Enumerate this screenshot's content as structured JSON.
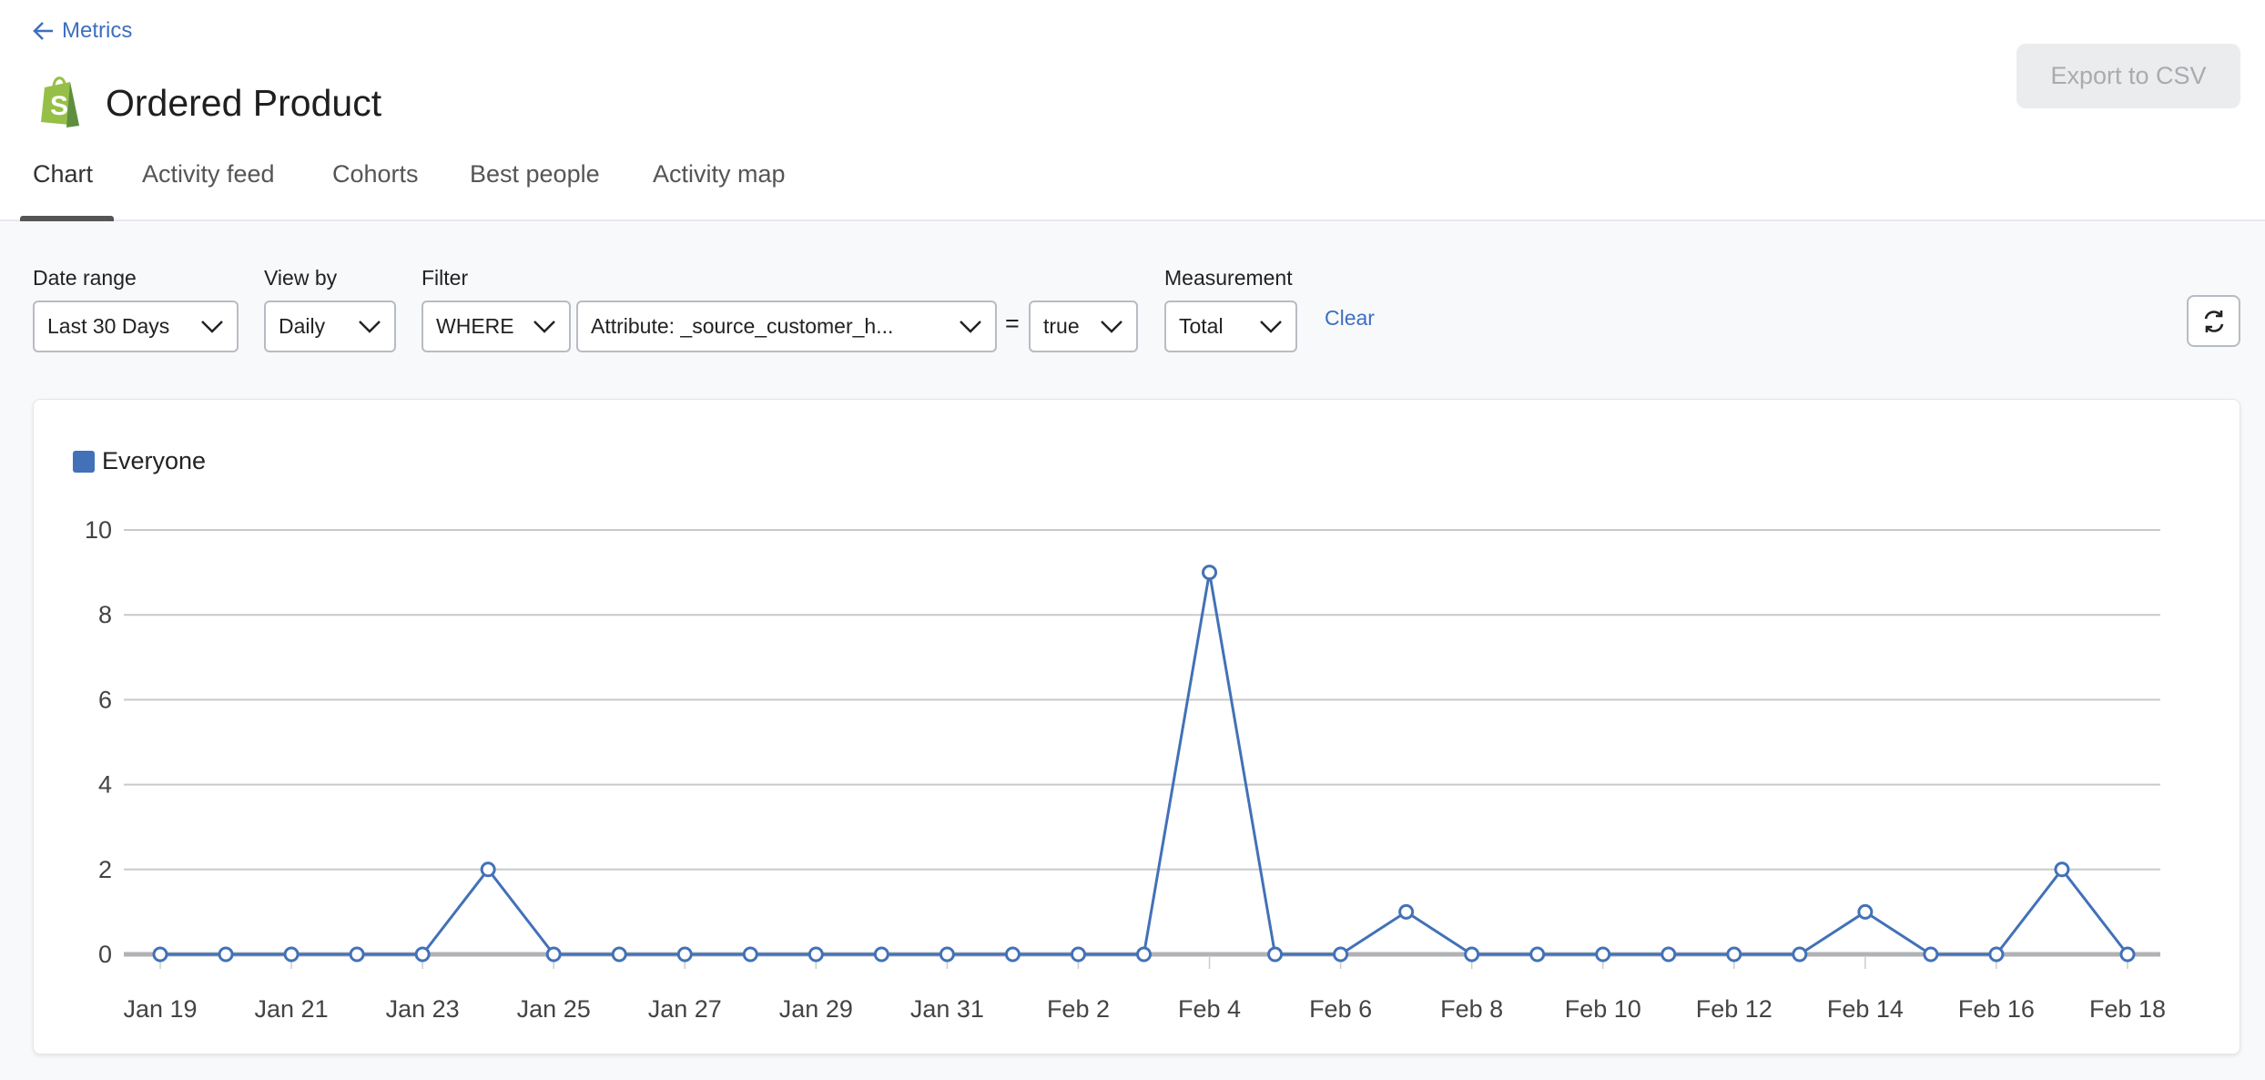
{
  "nav": {
    "back_label": "Metrics"
  },
  "header": {
    "title": "Ordered Product",
    "export_label": "Export to CSV",
    "logo": "shopify-bag-logo"
  },
  "tabs": [
    {
      "label": "Chart",
      "active": true
    },
    {
      "label": "Activity feed"
    },
    {
      "label": "Cohorts"
    },
    {
      "label": "Best people"
    },
    {
      "label": "Activity map"
    }
  ],
  "filters": {
    "date_range": {
      "label": "Date range",
      "value": "Last 30 Days"
    },
    "view_by": {
      "label": "View by",
      "value": "Daily"
    },
    "filter": {
      "label": "Filter",
      "clause": "WHERE",
      "attribute": "Attribute: _source_customer_h...",
      "operator": "=",
      "value": "true"
    },
    "measurement": {
      "label": "Measurement",
      "value": "Total"
    },
    "clear_label": "Clear"
  },
  "colors": {
    "series": "#4271b7",
    "link": "#3d6fc0",
    "shopify_green": "#95bf47"
  },
  "chart_data": {
    "type": "line",
    "legend": [
      "Everyone"
    ],
    "legend_placement": "top-left",
    "grid": true,
    "ylim": [
      0,
      10
    ],
    "yticks": [
      0,
      2,
      4,
      6,
      8,
      10
    ],
    "x": [
      "Jan 19",
      "Jan 20",
      "Jan 21",
      "Jan 22",
      "Jan 23",
      "Jan 24",
      "Jan 25",
      "Jan 26",
      "Jan 27",
      "Jan 28",
      "Jan 29",
      "Jan 30",
      "Jan 31",
      "Feb 1",
      "Feb 2",
      "Feb 3",
      "Feb 4",
      "Feb 5",
      "Feb 6",
      "Feb 7",
      "Feb 8",
      "Feb 9",
      "Feb 10",
      "Feb 11",
      "Feb 12",
      "Feb 13",
      "Feb 14",
      "Feb 15",
      "Feb 16",
      "Feb 17",
      "Feb 18"
    ],
    "xtick_labels": [
      "Jan 19",
      "Jan 21",
      "Jan 23",
      "Jan 25",
      "Jan 27",
      "Jan 29",
      "Jan 31",
      "Feb 2",
      "Feb 4",
      "Feb 6",
      "Feb 8",
      "Feb 10",
      "Feb 12",
      "Feb 14",
      "Feb 16",
      "Feb 18"
    ],
    "series": [
      {
        "name": "Everyone",
        "values": [
          0,
          0,
          0,
          0,
          0,
          2,
          0,
          0,
          0,
          0,
          0,
          0,
          0,
          0,
          0,
          0,
          9,
          0,
          0,
          1,
          0,
          0,
          0,
          0,
          0,
          0,
          1,
          0,
          0,
          2,
          0
        ]
      }
    ]
  }
}
